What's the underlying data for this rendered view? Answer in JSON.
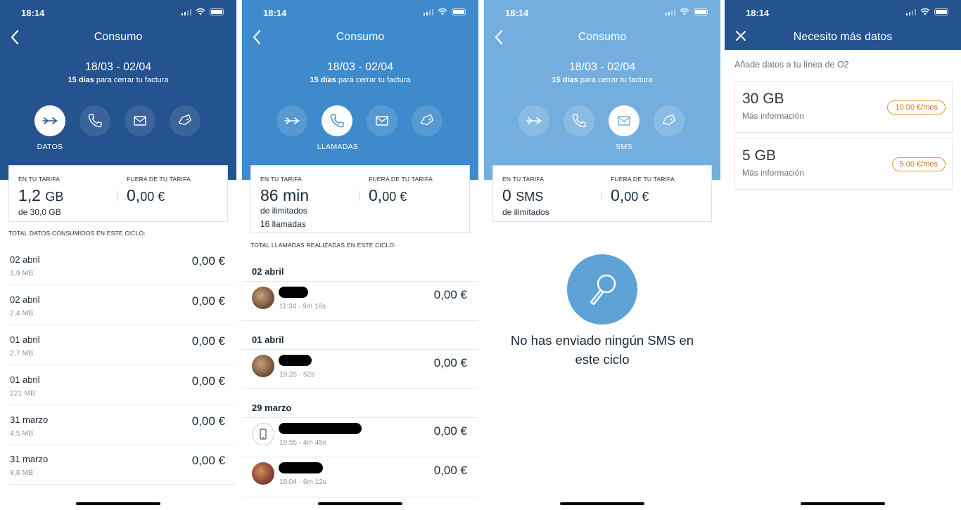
{
  "status": {
    "time": "18:14"
  },
  "consumo": {
    "title": "Consumo",
    "period": "18/03 - 02/04",
    "days_bold": "15 días",
    "days_rest": " para cerrar tu factura",
    "tab_labels": {
      "datos": "DATOS",
      "llamadas": "LLAMADAS",
      "sms": "SMS"
    }
  },
  "card_labels": {
    "in_tariff": "EN TU TARIFA",
    "out_tariff": "FUERA DE TU TARIFA"
  },
  "datos": {
    "in_value": "1,2",
    "in_unit": "GB",
    "in_sub": "de 30,0 GB",
    "out_int": "0,",
    "out_dec": "00 €",
    "section_title": "TOTAL DATOS CONSUMIDOS EN ESTE CICLO:",
    "rows": [
      {
        "date": "02 abril",
        "amount": "1,9 MB",
        "price": "0,00 €"
      },
      {
        "date": "02 abril",
        "amount": "2,4 MB",
        "price": "0,00 €"
      },
      {
        "date": "01 abril",
        "amount": "2,7 MB",
        "price": "0,00 €"
      },
      {
        "date": "01 abril",
        "amount": "221 MB",
        "price": "0,00 €"
      },
      {
        "date": "31 marzo",
        "amount": "4,5 MB",
        "price": "0,00 €"
      },
      {
        "date": "31 marzo",
        "amount": "8,8 MB",
        "price": "0,00 €"
      }
    ]
  },
  "llamadas": {
    "in_value": "86 min",
    "in_sub1": "de ilimitados",
    "in_sub2": "16 llamadas",
    "out_int": "0,",
    "out_dec": "00 €",
    "section_title": "TOTAL LLAMADAS REALIZADAS EN ESTE CICLO:",
    "groups": [
      {
        "day": "02 abril",
        "calls": [
          {
            "time": "11:34 - 9m 16s",
            "price": "0,00 €"
          }
        ]
      },
      {
        "day": "01 abril",
        "calls": [
          {
            "time": "19:25 - 52s",
            "price": "0,00 €"
          }
        ]
      },
      {
        "day": "29 marzo",
        "calls": [
          {
            "time": "19:55 - 4m 45s",
            "price": "0,00 €"
          },
          {
            "time": "18:04 - 6m 12s",
            "price": "0,00 €"
          }
        ]
      }
    ]
  },
  "sms": {
    "in_value": "0",
    "in_unit": "SMS",
    "in_sub": "de ilimitados",
    "out_int": "0,",
    "out_dec": "00 €",
    "empty_message": "No has enviado ningún SMS en este ciclo"
  },
  "mas_datos": {
    "title": "Necesito más datos",
    "subtitle": "Añade datos a tu línea de O2",
    "packs": [
      {
        "size": "30 GB",
        "more": "Más información",
        "price": "10.00 €/mes"
      },
      {
        "size": "5 GB",
        "more": "Más información",
        "price": "5.00 €/mes"
      }
    ]
  },
  "colors": {
    "datos_header": "#24538f",
    "llamadas_header": "#3e8acb",
    "sms_header": "#74aede",
    "price_badge": "#e3963a"
  }
}
